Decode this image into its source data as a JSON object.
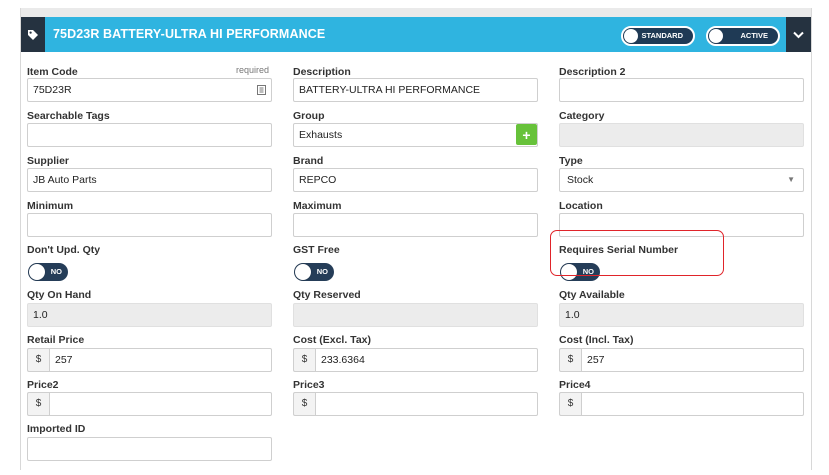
{
  "header": {
    "title": "75D23R BATTERY-ULTRA HI PERFORMANCE",
    "standard_label": "STANDARD",
    "active_label": "ACTIVE",
    "accent_color": "#2fb4e0",
    "dark_color": "#253240"
  },
  "fields": {
    "item_code": {
      "label": "Item Code",
      "required": "required",
      "value": "75D23R"
    },
    "description": {
      "label": "Description",
      "value": "BATTERY-ULTRA HI PERFORMANCE"
    },
    "description2": {
      "label": "Description 2",
      "value": ""
    },
    "searchable_tags": {
      "label": "Searchable Tags",
      "value": ""
    },
    "group": {
      "label": "Group",
      "value": "Exhausts",
      "add_label": "+"
    },
    "category": {
      "label": "Category",
      "value": ""
    },
    "supplier": {
      "label": "Supplier",
      "value": "JB Auto Parts"
    },
    "brand": {
      "label": "Brand",
      "value": "REPCO"
    },
    "type": {
      "label": "Type",
      "value": "Stock"
    },
    "minimum": {
      "label": "Minimum",
      "value": ""
    },
    "maximum": {
      "label": "Maximum",
      "value": ""
    },
    "location": {
      "label": "Location",
      "value": ""
    },
    "dont_upd_qty": {
      "label": "Don't Upd. Qty",
      "toggle": "NO"
    },
    "gst_free": {
      "label": "GST Free",
      "toggle": "NO"
    },
    "requires_serial": {
      "label": "Requires Serial Number",
      "toggle": "NO"
    },
    "qty_on_hand": {
      "label": "Qty On Hand",
      "value": "1.0"
    },
    "qty_reserved": {
      "label": "Qty Reserved",
      "value": ""
    },
    "qty_available": {
      "label": "Qty Available",
      "value": "1.0"
    },
    "retail_price": {
      "label": "Retail Price",
      "prefix": "$",
      "value": "257"
    },
    "cost_excl": {
      "label": "Cost (Excl. Tax)",
      "prefix": "$",
      "value": "233.6364"
    },
    "cost_incl": {
      "label": "Cost (Incl. Tax)",
      "prefix": "$",
      "value": "257"
    },
    "price2": {
      "label": "Price2",
      "prefix": "$",
      "value": ""
    },
    "price3": {
      "label": "Price3",
      "prefix": "$",
      "value": ""
    },
    "price4": {
      "label": "Price4",
      "prefix": "$",
      "value": ""
    },
    "imported_id": {
      "label": "Imported ID",
      "value": ""
    }
  }
}
